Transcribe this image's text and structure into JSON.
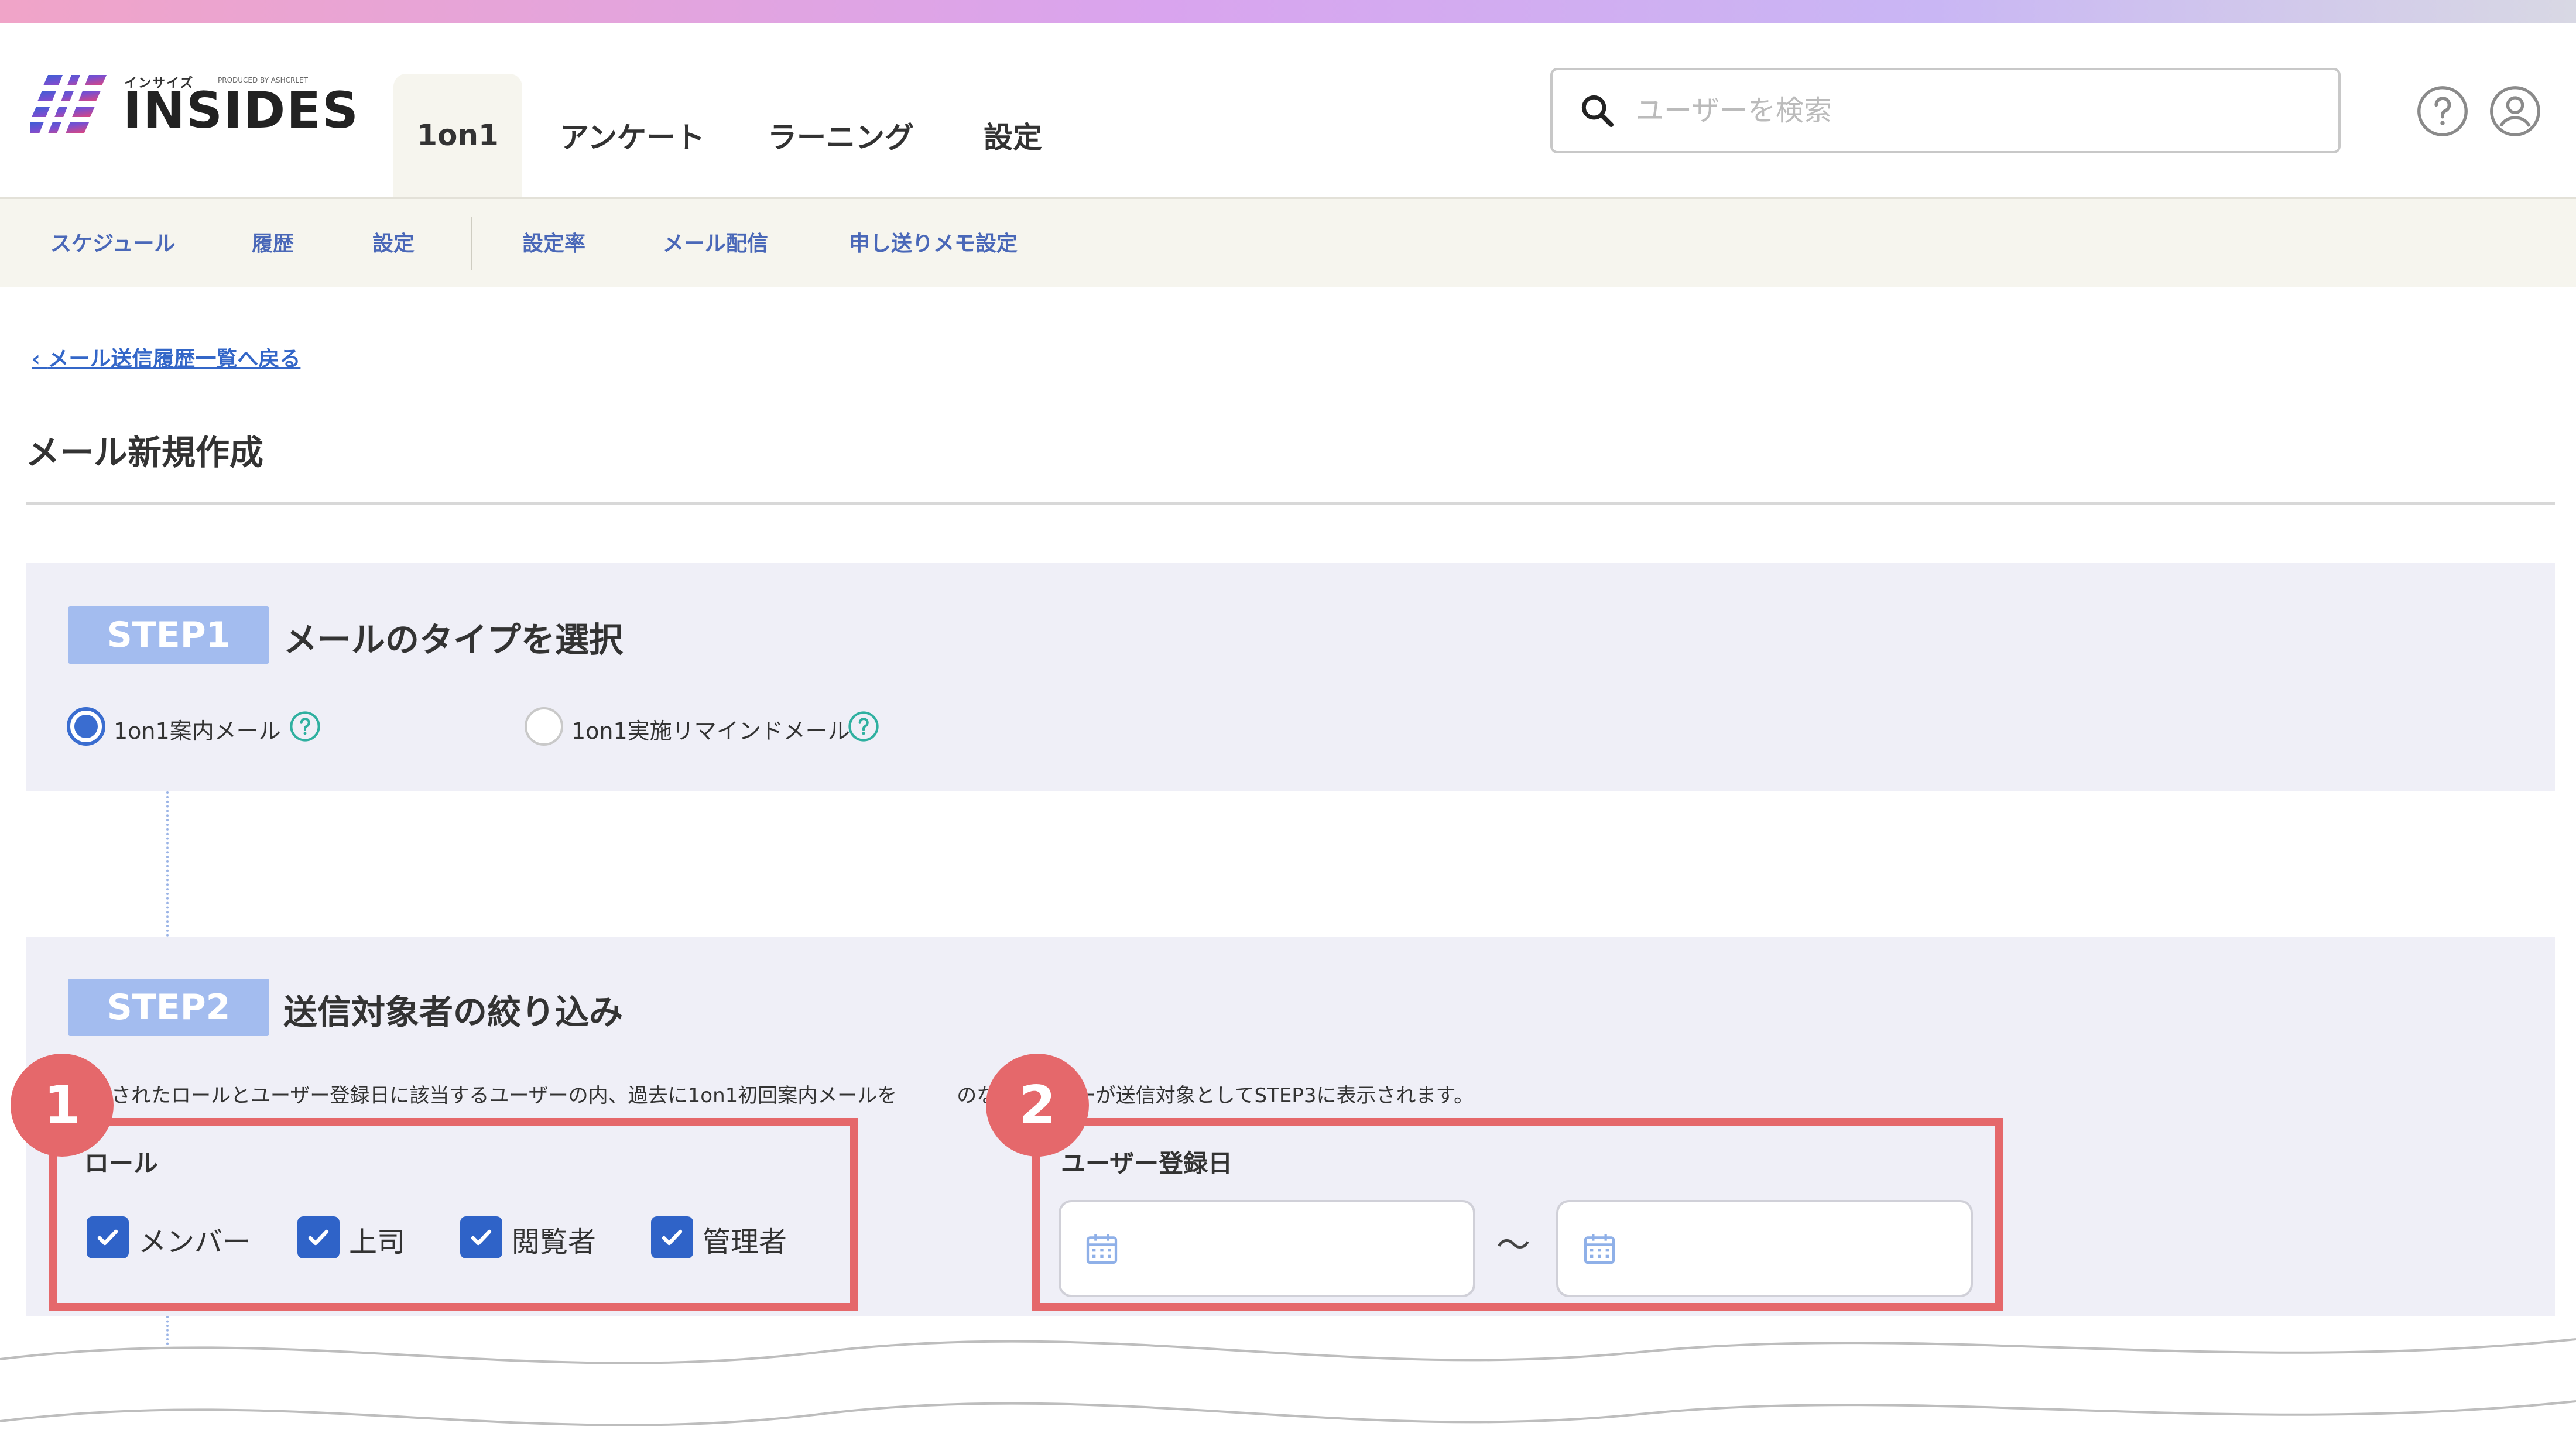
{
  "colors": {
    "accent_blue": "#2f63c8",
    "link_blue": "#3467c8",
    "step_badge": "#a3bcef",
    "panel_bg": "#efeff7",
    "subnav_bg": "#f6f5ee",
    "annotation_red": "#e5686b"
  },
  "header": {
    "logo_small": "インサイズ",
    "logo_produced": "PRODUCED BY ASHCRLET",
    "logo_text": "INSIDES",
    "tabs": [
      {
        "label": "1on1",
        "active": true
      },
      {
        "label": "アンケート",
        "active": false
      },
      {
        "label": "ラーニング",
        "active": false
      },
      {
        "label": "設定",
        "active": false
      }
    ],
    "search": {
      "placeholder": "ユーザーを検索",
      "value": "",
      "icon": "search-icon"
    },
    "help_icon": "help-circle-icon",
    "user_icon": "user-circle-icon"
  },
  "subnav": {
    "items": [
      {
        "label": "スケジュール"
      },
      {
        "label": "履歴"
      },
      {
        "label": "設定"
      },
      {
        "label": "設定率"
      },
      {
        "label": "メール配信"
      },
      {
        "label": "申し送りメモ設定"
      }
    ]
  },
  "breadcrumb": {
    "back_label": "メール送信履歴一覧へ戻る"
  },
  "page": {
    "title": "メール新規作成"
  },
  "step1": {
    "badge": "STEP1",
    "title": "メールのタイプを選択",
    "options": [
      {
        "label": "1on1案内メール",
        "selected": true
      },
      {
        "label": "1on1実施リマインドメール",
        "selected": false
      }
    ]
  },
  "step2": {
    "badge": "STEP2",
    "title": "送信対象者の絞り込み",
    "description": "されたロールとユーザー登録日に該当するユーザーの内、過去に1on1初回案内メールを　　　のないユーザーが送信対象としてSTEP3に表示されます。",
    "role": {
      "label": "ロール",
      "options": [
        {
          "label": "メンバー",
          "checked": true
        },
        {
          "label": "上司",
          "checked": true
        },
        {
          "label": "閲覧者",
          "checked": true
        },
        {
          "label": "管理者",
          "checked": true
        }
      ]
    },
    "registration_date": {
      "label": "ユーザー登録日",
      "from": "",
      "to": "",
      "separator": "〜"
    }
  },
  "annotations": {
    "marker1": "1",
    "marker2": "2"
  }
}
